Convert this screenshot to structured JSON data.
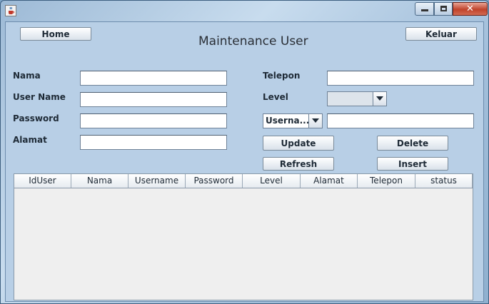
{
  "window": {
    "title": "",
    "controls": {
      "minimize": "",
      "maximize": "",
      "close": "✕"
    }
  },
  "header": {
    "title": "Maintenance User",
    "home_label": "Home",
    "keluar_label": "Keluar"
  },
  "form": {
    "labels": {
      "nama": "Nama",
      "username": "User Name",
      "password": "Password",
      "alamat": "Alamat",
      "telepon": "Telepon",
      "level": "Level"
    },
    "values": {
      "nama": "",
      "username": "",
      "password": "",
      "alamat": "",
      "telepon": "",
      "level": "",
      "search": ""
    },
    "search_by_selected": "Userna..."
  },
  "actions": {
    "update": "Update",
    "delete": "Delete",
    "refresh": "Refresh",
    "insert": "Insert"
  },
  "table": {
    "columns": [
      "IdUser",
      "Nama",
      "Username",
      "Password",
      "Level",
      "Alamat",
      "Telepon",
      "status"
    ],
    "rows": []
  },
  "icons": {
    "app": "java-cup-icon",
    "dropdown": "chevron-down-icon"
  }
}
